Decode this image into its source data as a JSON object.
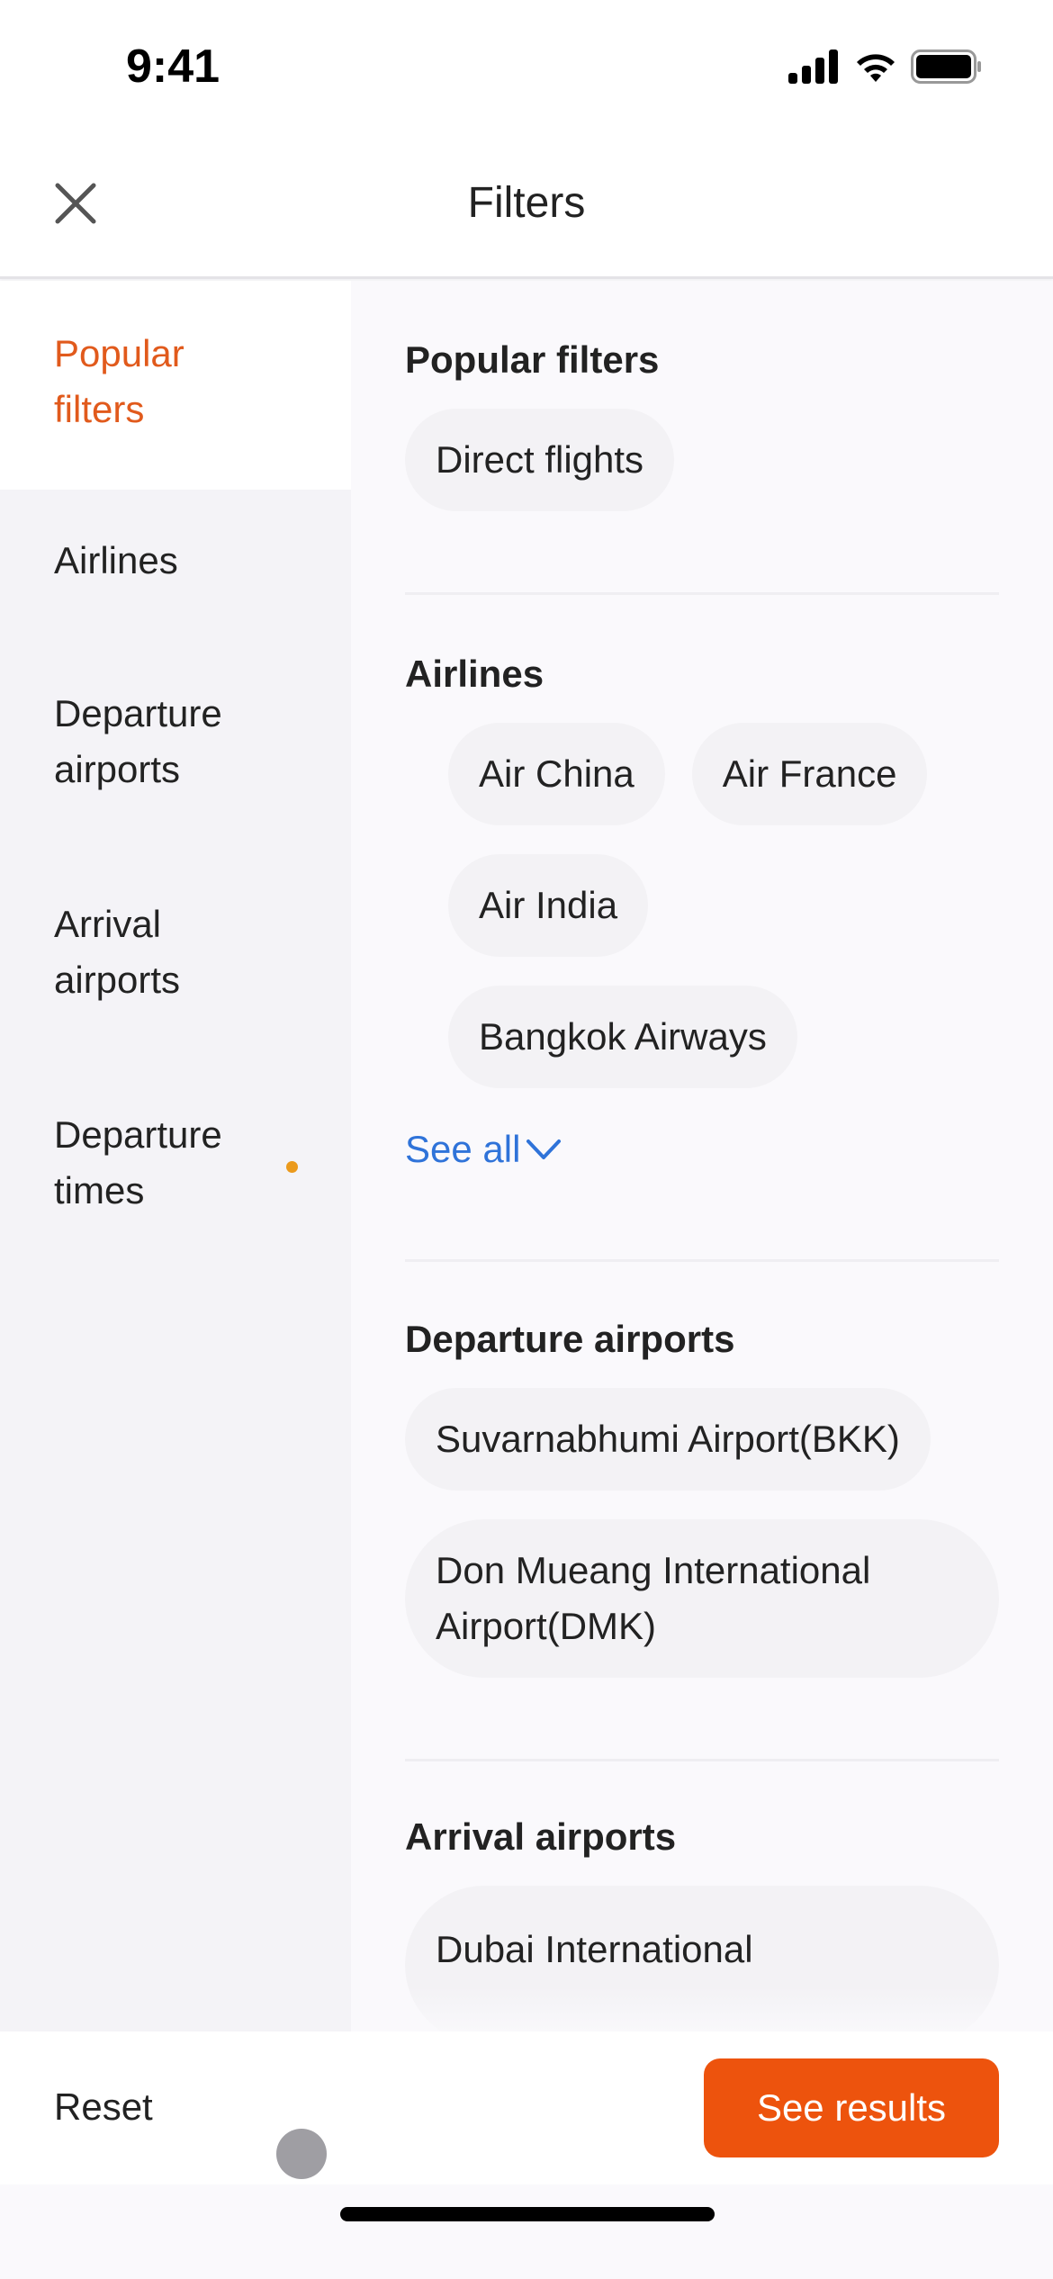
{
  "status_bar": {
    "time": "9:41"
  },
  "header": {
    "title": "Filters",
    "close_icon": "close-icon"
  },
  "sidebar": {
    "items": [
      {
        "label": "Popular filters",
        "active": true,
        "has_indicator": false
      },
      {
        "label": "Airlines",
        "active": false,
        "has_indicator": false
      },
      {
        "label": "Departure airports",
        "active": false,
        "has_indicator": false
      },
      {
        "label": "Arrival airports",
        "active": false,
        "has_indicator": false
      },
      {
        "label": "Departure times",
        "active": false,
        "has_indicator": true
      }
    ]
  },
  "sections": {
    "popular": {
      "title": "Popular filters",
      "chips": [
        "Direct flights"
      ]
    },
    "airlines": {
      "title": "Airlines",
      "chips": [
        "Air China",
        "Air France",
        "Air India",
        "Bangkok Airways"
      ],
      "see_all_label": "See all"
    },
    "departure_airports": {
      "title": "Departure airports",
      "chips": [
        "Suvarnabhumi Airport(BKK)",
        "Don Mueang International Airport(DMK)"
      ]
    },
    "arrival_airports": {
      "title": "Arrival airports",
      "chips": [
        "Dubai International"
      ]
    }
  },
  "footer": {
    "reset_label": "Reset",
    "results_label": "See results"
  },
  "colors": {
    "accent": "#ed530d",
    "active_nav": "#e15a1c",
    "link": "#2f73d9",
    "indicator_dot": "#eb9a1d"
  }
}
